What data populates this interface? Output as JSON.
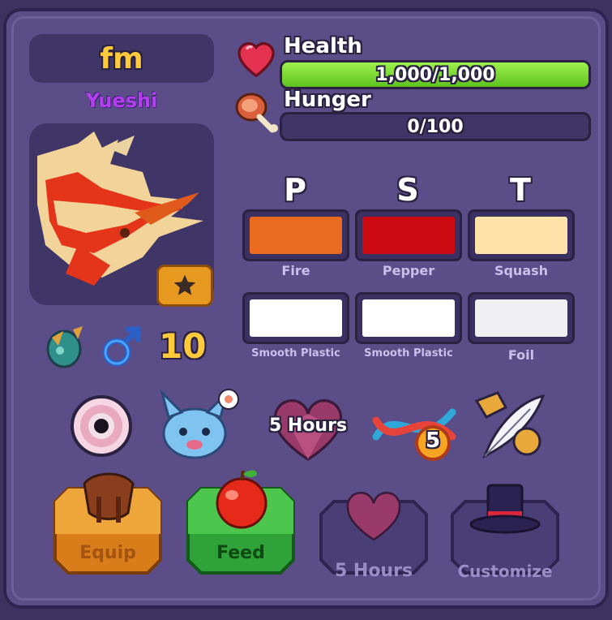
{
  "pet": {
    "name": "fm",
    "species": "Yueshi",
    "level": "10"
  },
  "stats": {
    "health": {
      "label": "Health",
      "text": "1,000/1,000",
      "fraction": 1.0
    },
    "hunger": {
      "label": "Hunger",
      "text": "0/100",
      "fraction": 0.0
    }
  },
  "colors": {
    "letters": [
      "P",
      "S",
      "T"
    ],
    "row1": [
      {
        "label": "Fire",
        "color": "#ea6a1f"
      },
      {
        "label": "Pepper",
        "color": "#cc0a12"
      },
      {
        "label": "Squash",
        "color": "#fde3a9"
      }
    ],
    "row2": [
      {
        "label": "Smooth Plastic",
        "color": "#ffffff"
      },
      {
        "label": "Smooth Plastic",
        "color": "#ffffff"
      },
      {
        "label": "Foil",
        "color": "#f0f0f2"
      }
    ]
  },
  "traits": {
    "timer_label": "5 Hours",
    "dna_count": "5"
  },
  "actions": {
    "equip_label": "Equip",
    "feed_label": "Feed",
    "love_label": "5 Hours",
    "customize_label": "Customize"
  },
  "accent_colors": {
    "panel": "#5a4d88",
    "dark": "#3f3566",
    "gold": "#ffc93c",
    "species": "#b43ef0"
  }
}
